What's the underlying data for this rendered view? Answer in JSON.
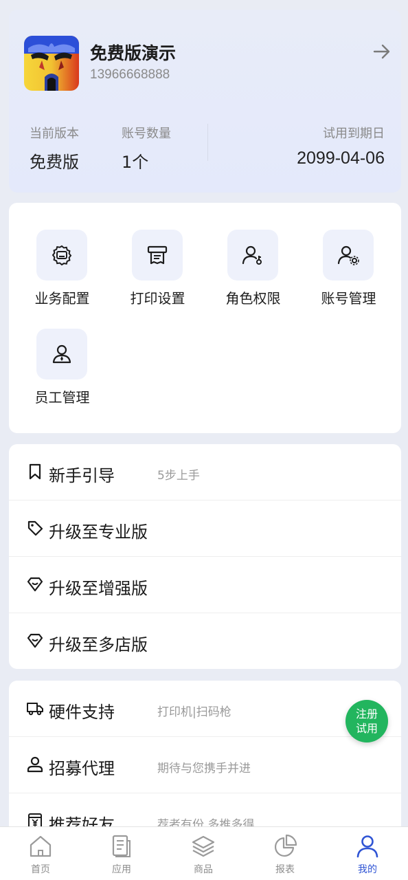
{
  "profile": {
    "name": "免费版演示",
    "phone": "13966668888",
    "stats": {
      "version_label": "当前版本",
      "version_value": "免费版",
      "accounts_label": "账号数量",
      "accounts_value": "1个",
      "expiry_label": "试用到期日",
      "expiry_value": "2099-04-06"
    }
  },
  "functions": [
    {
      "label": "业务配置",
      "icon": "business-config-icon"
    },
    {
      "label": "打印设置",
      "icon": "printer-icon"
    },
    {
      "label": "角色权限",
      "icon": "role-permission-icon"
    },
    {
      "label": "账号管理",
      "icon": "account-manage-icon"
    },
    {
      "label": "员工管理",
      "icon": "staff-icon"
    }
  ],
  "list_one": [
    {
      "label": "新手引导",
      "sub": "5步上手",
      "icon": "bookmark-icon"
    },
    {
      "label": "升级至专业版",
      "sub": "",
      "icon": "tag-icon"
    },
    {
      "label": "升级至增强版",
      "sub": "",
      "icon": "diamond-icon"
    },
    {
      "label": "升级至多店版",
      "sub": "",
      "icon": "diamond-icon"
    }
  ],
  "list_two": [
    {
      "label": "硬件支持",
      "sub": "打印机|扫码枪",
      "icon": "truck-icon"
    },
    {
      "label": "招募代理",
      "sub": "期待与您携手并进",
      "icon": "person-icon"
    },
    {
      "label": "推荐好友",
      "sub": "荐者有份 多推多得",
      "icon": "yen-box-icon"
    }
  ],
  "fab": {
    "line1": "注册",
    "line2": "试用"
  },
  "tabs": [
    {
      "label": "首页",
      "icon": "home-icon",
      "active": false
    },
    {
      "label": "应用",
      "icon": "document-icon",
      "active": false
    },
    {
      "label": "商品",
      "icon": "layers-icon",
      "active": false
    },
    {
      "label": "报表",
      "icon": "pie-chart-icon",
      "active": false
    },
    {
      "label": "我的",
      "icon": "user-icon",
      "active": true
    }
  ],
  "colors": {
    "accent": "#2f54d4",
    "fab_green": "#22b55e",
    "background": "#e9ecf4"
  }
}
